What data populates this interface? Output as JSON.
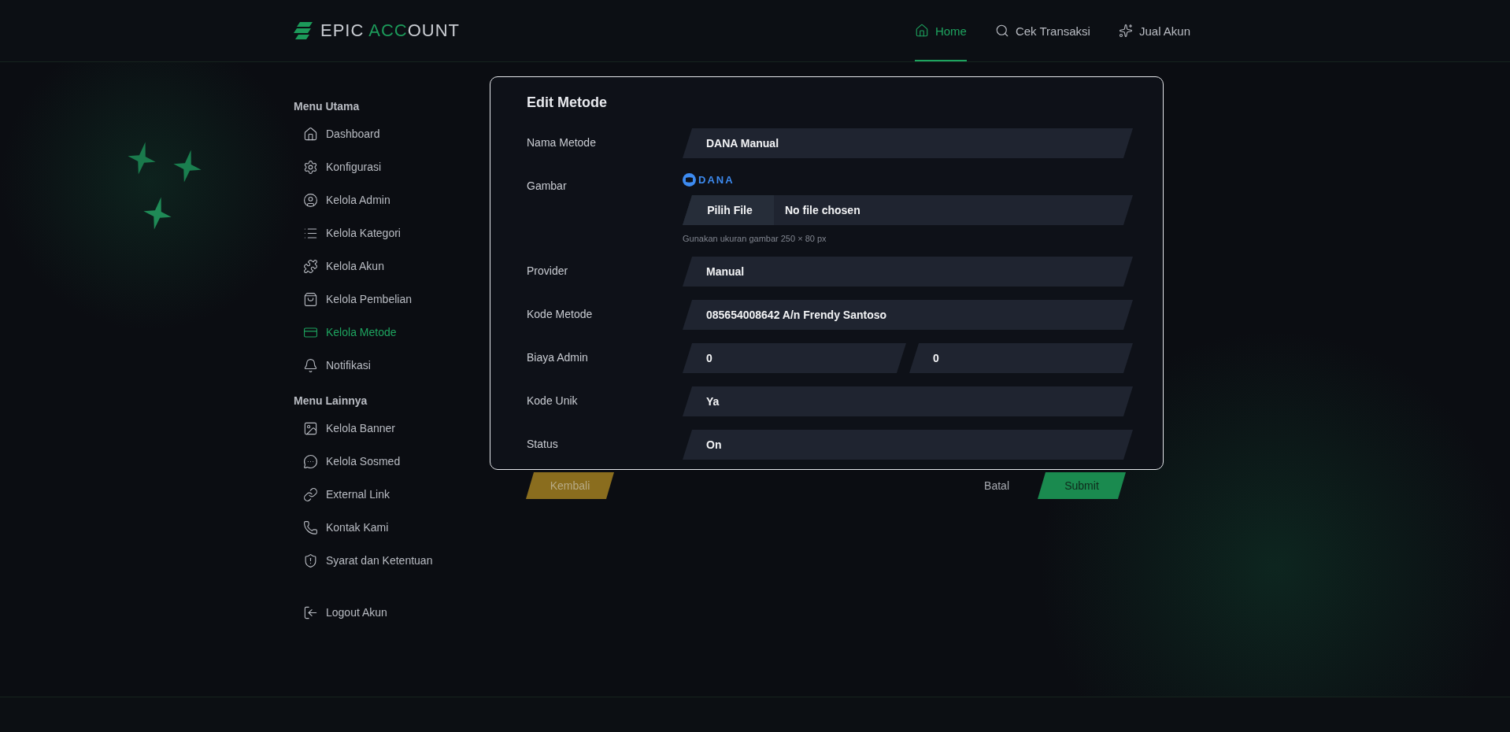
{
  "header": {
    "logo": {
      "part_1": "EPIC",
      "part_2": "ACC",
      "part_3": "OUNT"
    },
    "nav": [
      {
        "label": "Home",
        "selected": true
      },
      {
        "label": "Cek Transaksi",
        "selected": false
      },
      {
        "label": "Jual Akun",
        "selected": false
      }
    ]
  },
  "sidebar": {
    "sections": [
      {
        "title": "Menu Utama",
        "items": [
          {
            "label": "Dashboard",
            "selected": false
          },
          {
            "label": "Konfigurasi",
            "selected": false
          },
          {
            "label": "Kelola Admin",
            "selected": false
          },
          {
            "label": "Kelola Kategori",
            "selected": false
          },
          {
            "label": "Kelola Akun",
            "selected": false
          },
          {
            "label": "Kelola Pembelian",
            "selected": false
          },
          {
            "label": "Kelola Metode",
            "selected": true
          },
          {
            "label": "Notifikasi",
            "selected": false
          }
        ]
      },
      {
        "title": "Menu Lainnya",
        "items": [
          {
            "label": "Kelola Banner",
            "selected": false
          },
          {
            "label": "Kelola Sosmed",
            "selected": false
          },
          {
            "label": "External Link",
            "selected": false
          },
          {
            "label": "Kontak Kami",
            "selected": false
          },
          {
            "label": "Syarat dan Ketentuan",
            "selected": false
          }
        ]
      }
    ],
    "logout": "Logout Akun"
  },
  "form": {
    "title": "Edit Metode",
    "rows": [
      {
        "kind": "text",
        "label": "Nama Metode",
        "value": "DANA Manual"
      },
      {
        "kind": "file",
        "label": "Gambar",
        "logo": "DANA",
        "button": "Pilih File",
        "value": "No file chosen",
        "hint": "Gunakan ukuran gambar 250 × 80 px"
      },
      {
        "kind": "text",
        "label": "Provider",
        "value": "Manual"
      },
      {
        "kind": "text",
        "label": "Kode Metode",
        "value": "085654008642 A/n Frendy Santoso"
      },
      {
        "kind": "pair",
        "label": "Biaya Admin",
        "values": [
          "0",
          "0"
        ]
      },
      {
        "kind": "text",
        "label": "Kode Unik",
        "value": "Ya"
      },
      {
        "kind": "text",
        "label": "Status",
        "value": "On"
      }
    ]
  },
  "actions": {
    "back": "Kembali",
    "cancel": "Batal",
    "submit": "Submit"
  }
}
